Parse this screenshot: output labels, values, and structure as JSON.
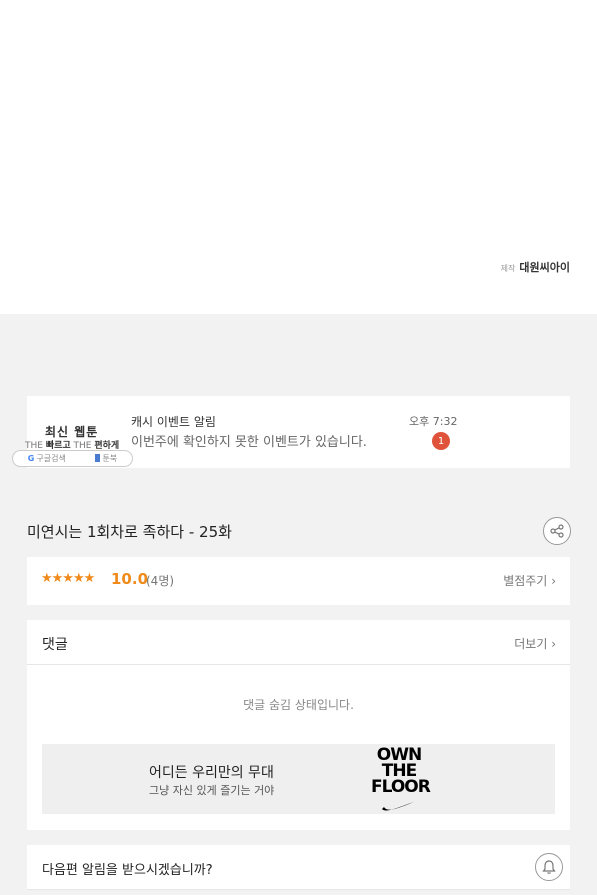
{
  "credit": {
    "label": "제작",
    "value": "대원씨아이"
  },
  "promo": {
    "title": "최신 웹툰",
    "tagline_parts": [
      "THE",
      "빠르고",
      "THE",
      "편하게"
    ],
    "google": "구글검색",
    "bookcube": "툰북"
  },
  "notice": {
    "title": "캐시 이벤트 알림",
    "message": "이번주에 확인하지 못한 이벤트가 있습니다.",
    "time": "오후 7:32",
    "badge": "1"
  },
  "episode": {
    "title": "미연시는 1회차로 족하다 - 25화",
    "share_icon": "share-icon"
  },
  "rating": {
    "stars": "★★★★★",
    "star_count": 5,
    "score": "10.0",
    "voters": "(4명)",
    "rate_link": "별점주기",
    "accent": "#ef8a1b"
  },
  "comments": {
    "label": "댓글",
    "more": "더보기",
    "hidden_message": "댓글 숨김 상태입니다."
  },
  "ad": {
    "headline": "어디든 우리만의 무대",
    "sub": "그냥 자신 있게 즐기는 거야",
    "logo_lines": [
      "OWN",
      "THE",
      "FLOOR"
    ]
  },
  "notify": {
    "question": "다음편 알림을 받으시겠습니까?",
    "bell_icon": "bell-icon"
  },
  "colors": {
    "badge": "#e0533b",
    "background": "#f2f2f2"
  }
}
